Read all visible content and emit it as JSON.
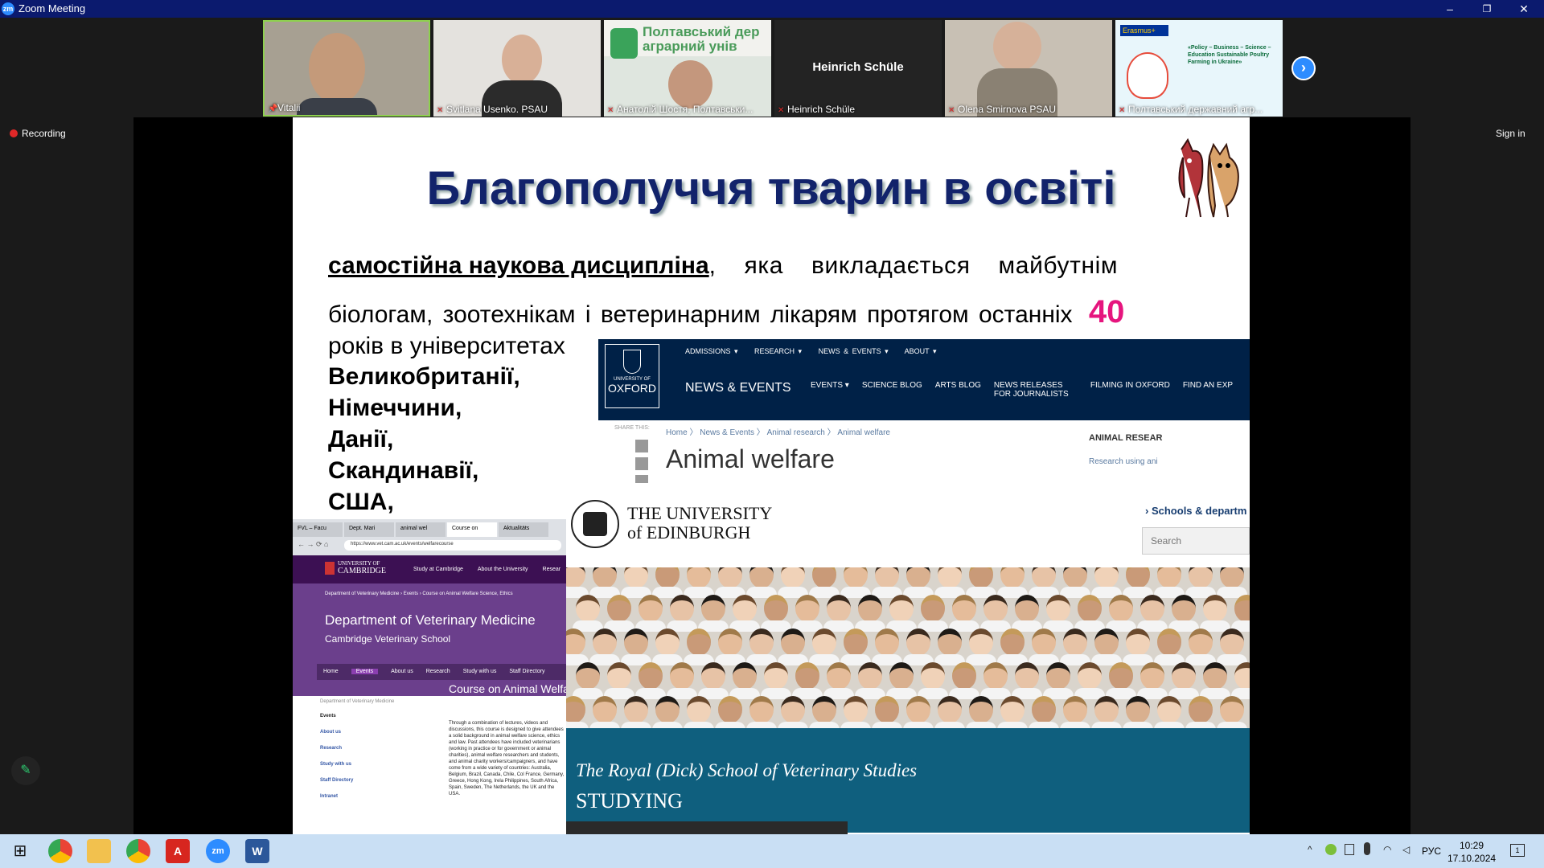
{
  "window": {
    "title": "Zoom Meeting",
    "logo_text": "zm",
    "minimize": "–",
    "restore": "❐",
    "close": "✕"
  },
  "participants": [
    {
      "name": "Vitalii"
    },
    {
      "name": "Svitlana Usenko. PSAU"
    },
    {
      "name": "Анатолій Шостя, Полтавськи...",
      "banner": "Полтавський дер аграрний унів"
    },
    {
      "name": "Heinrich Schüle",
      "center_label": "Heinrich Schüle"
    },
    {
      "name": "Olena Smirnova PSAU"
    },
    {
      "name": "Полтавський державний агр...",
      "banner": "Erasmus+",
      "banner2": "«Policy – Business – Science – Education Sustainable Poultry Farming in Ukraine»"
    }
  ],
  "controls": {
    "next_arrow": "›",
    "recording_label": "Recording",
    "signin_label": "Sign in",
    "pencil": "✎"
  },
  "slide": {
    "title": "Благополуччя тварин в освіті",
    "line1_underlined": "самостійна наукова дисципліна",
    "line1_rest": ", яка викладається майбутнім",
    "line2": "біологам, зоотехнікам і ветеринарним лікарям протягом останніх",
    "highlight_number": "40",
    "line3": "років в університетах",
    "countries": [
      "Великобританії,",
      "Німеччини,",
      "Данії,",
      "Скандинавії,",
      "США,"
    ]
  },
  "oxford": {
    "logo_line1": "UNIVERSITY OF",
    "logo_line2": "OXFORD",
    "top_menu": [
      "ADMISSIONS ▾",
      "RESEARCH ▾",
      "NEWS & EVENTS ▾",
      "ABOUT ▾"
    ],
    "section": "NEWS & EVENTS",
    "sub_menu": [
      "EVENTS ▾",
      "SCIENCE BLOG",
      "ARTS BLOG",
      "NEWS RELEASES FOR JOURNALISTS",
      "FILMING IN OXFORD",
      "FIND AN EXP"
    ],
    "share_label": "SHARE THIS:",
    "breadcrumb": "Home 〉 News & Events 〉 Animal research 〉 Animal welfare",
    "page_title": "Animal welfare",
    "side_heading": "ANIMAL RESEAR",
    "side_link": "Research using ani"
  },
  "edinburgh": {
    "line1": "THE UNIVERSITY",
    "line2": "of EDINBURGH",
    "schools_link": "Schools & departm",
    "search_placeholder": "Search",
    "band_title": "The Royal (Dick) School of Veterinary Studies",
    "band_subtitle": "STUDYING"
  },
  "cambridge": {
    "url": "https://www.vet.cam.ac.uk/events/welfarecourse",
    "tabs": [
      "FVL – Facu",
      "Dept. Mari",
      "animal wel",
      "Course on",
      "Aktualitäts"
    ],
    "logo_line1": "UNIVERSITY OF",
    "logo_line2": "CAMBRIDGE",
    "top_links": [
      "Study at Cambridge",
      "About the University",
      "Resear"
    ],
    "breadcrumb": "Department of Veterinary Medicine › Events › Course on Animal Welfare Science, Ethics",
    "dept_title": "Department of Veterinary Medicine",
    "dept_subtitle": "Cambridge Veterinary School",
    "nav": [
      "Home",
      "Events",
      "About us",
      "Research",
      "Study with us",
      "Staff Directory"
    ],
    "course_title": "Course on Animal Welfa",
    "side_heading": "Department of Veterinary Medicine",
    "side_items": [
      "Events",
      "About us",
      "Research",
      "Study with us",
      "Staff Directory",
      "Intranet"
    ],
    "paragraph": "Through a combination of lectures, videos and discussions, this course is designed to give attendees a solid background in animal welfare science, ethics and law. Past attendees have included veterinarians (working in practice or for government or animal charities), animal welfare researchers and students, and animal charity workers/campaigners, and have come from a wide variety of countries: Australia, Belgium, Brazil, Canada, Chile, Col France, Germany, Greece, Hong Kong, Irela Philippines, South Africa, Spain, Sweden, The Netherlands, the UK and the USA."
  },
  "taskbar": {
    "start": "⊞",
    "apps": [
      "chrome-icon",
      "explorer-icon",
      "chrome-profile-icon",
      "acrobat-icon",
      "zoom-icon",
      "word-icon"
    ],
    "zoom_text": "zm",
    "word_text": "W",
    "acrobat_text": "A",
    "tray_language": "РУС",
    "time": "10:29",
    "date": "17.10.2024",
    "notification_count": "1"
  },
  "colors": {
    "titlebar": "#0b1a6e",
    "zoom_blue": "#2d8cff",
    "slide_title": "#12236b",
    "highlight": "#e6157e",
    "oxford": "#002147",
    "edinburgh_band": "#0f5f7e",
    "cambridge": "#6b3f8c"
  }
}
